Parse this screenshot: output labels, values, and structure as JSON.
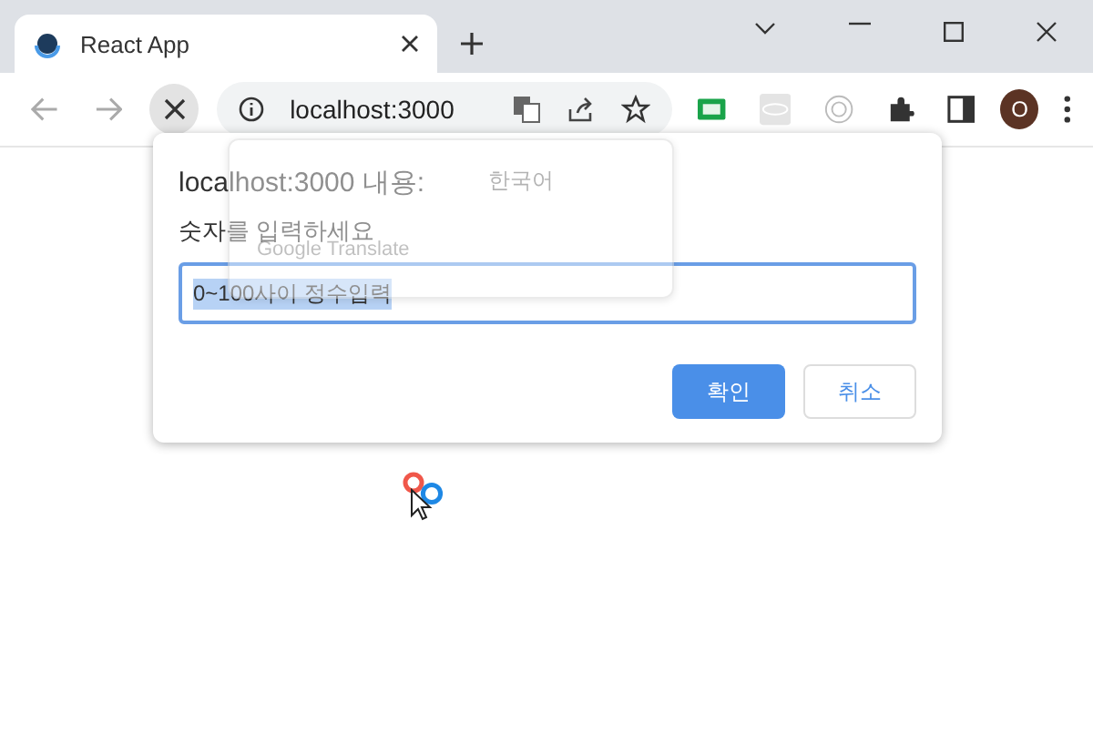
{
  "browser": {
    "tab": {
      "title": "React App",
      "loading": true
    },
    "address": "localhost:3000",
    "profile_initial": "O"
  },
  "dialog": {
    "title": "localhost:3000 내용:",
    "message": "숫자를 입력하세요",
    "input": {
      "value": "0~100사이 정수입력",
      "text_selected": true
    },
    "buttons": [
      {
        "label": "확인",
        "kind": "primary"
      },
      {
        "label": "취소",
        "kind": "secondary"
      }
    ]
  },
  "translate_popup": {
    "language": "한국어",
    "footer": "Google Translate"
  }
}
